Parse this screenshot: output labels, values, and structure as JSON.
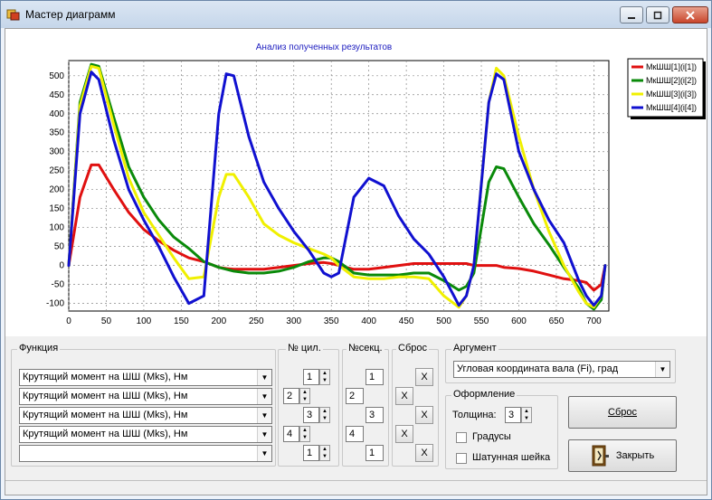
{
  "window": {
    "title": "Мастер диаграмм"
  },
  "chart_data": {
    "type": "line",
    "title": "Анализ полученных результатов",
    "xlim": [
      0,
      720
    ],
    "ylim": [
      -120,
      540
    ],
    "grid": true,
    "legend_position": "right",
    "x_ticks": [
      0,
      50,
      100,
      150,
      200,
      250,
      300,
      350,
      400,
      450,
      500,
      550,
      600,
      650,
      700
    ],
    "y_ticks": [
      -100,
      -50,
      0,
      50,
      100,
      150,
      200,
      250,
      300,
      350,
      400,
      450,
      500
    ],
    "colors": [
      "#e01010",
      "#0a8a0a",
      "#f0f000",
      "#1010d0"
    ],
    "x": [
      0,
      15,
      30,
      40,
      60,
      80,
      100,
      120,
      140,
      160,
      180,
      200,
      210,
      220,
      240,
      260,
      280,
      300,
      320,
      340,
      350,
      360,
      380,
      400,
      420,
      440,
      460,
      480,
      500,
      520,
      530,
      540,
      560,
      570,
      580,
      600,
      620,
      640,
      660,
      680,
      690,
      700,
      710,
      715
    ],
    "series": [
      {
        "name": "МкШШ[1](i[1])",
        "values": [
          0,
          180,
          265,
          265,
          200,
          140,
          95,
          65,
          40,
          20,
          10,
          -5,
          -8,
          -10,
          -10,
          -10,
          -5,
          0,
          5,
          8,
          5,
          0,
          -10,
          -10,
          -5,
          0,
          5,
          5,
          5,
          5,
          5,
          0,
          0,
          0,
          -5,
          -8,
          -15,
          -25,
          -35,
          -40,
          -45,
          -65,
          -50,
          0
        ]
      },
      {
        "name": "МкШШ[2](i[2])",
        "values": [
          0,
          430,
          530,
          525,
          390,
          260,
          180,
          120,
          75,
          45,
          10,
          -5,
          -10,
          -15,
          -20,
          -20,
          -15,
          -5,
          10,
          20,
          20,
          10,
          -20,
          -25,
          -25,
          -25,
          -20,
          -20,
          -40,
          -65,
          -55,
          -20,
          220,
          260,
          255,
          180,
          110,
          55,
          -5,
          -60,
          -100,
          -115,
          -90,
          0
        ]
      },
      {
        "name": "МкШШ[3](i[3])",
        "values": [
          0,
          420,
          525,
          520,
          370,
          230,
          140,
          80,
          20,
          -35,
          -30,
          180,
          240,
          240,
          180,
          110,
          80,
          60,
          45,
          30,
          20,
          0,
          -30,
          -35,
          -35,
          -30,
          -30,
          -35,
          -80,
          -110,
          -80,
          0,
          430,
          520,
          500,
          340,
          200,
          90,
          0,
          -70,
          -100,
          -110,
          -80,
          0
        ]
      },
      {
        "name": "МкШШ[4](i[4])",
        "values": [
          0,
          400,
          510,
          490,
          330,
          200,
          120,
          50,
          -30,
          -100,
          -80,
          400,
          505,
          500,
          340,
          220,
          150,
          90,
          40,
          -20,
          -30,
          -20,
          180,
          230,
          210,
          130,
          70,
          30,
          -30,
          -105,
          -80,
          0,
          430,
          505,
          490,
          300,
          200,
          120,
          60,
          -40,
          -80,
          -105,
          -80,
          0
        ]
      }
    ]
  },
  "function_group": {
    "label": "Функция",
    "combos": [
      "Крутящий момент на ШШ (Mks), Нм",
      "Крутящий момент на ШШ (Mks), Нм",
      "Крутящий момент на ШШ (Mks), Нм",
      "Крутящий момент на ШШ (Mks), Нм",
      ""
    ]
  },
  "cyl_group": {
    "label": "№ цил.",
    "values": [
      "1",
      "2",
      "3",
      "4",
      "1"
    ]
  },
  "sec_group": {
    "label": "№секц.",
    "values": [
      "1",
      "2",
      "3",
      "4",
      "1"
    ]
  },
  "reset_group": {
    "label": "Сброс",
    "x": "X"
  },
  "argument_group": {
    "label": "Аргумент",
    "value": "Угловая координата вала (Fi), град"
  },
  "style_group": {
    "label": "Оформление",
    "thickness_label": "Толщина:",
    "thickness_value": "3",
    "degrees_label": "Градусы",
    "crank_label": "Шатунная шейка"
  },
  "buttons": {
    "reset": "Сброс",
    "close": "Закрыть"
  }
}
